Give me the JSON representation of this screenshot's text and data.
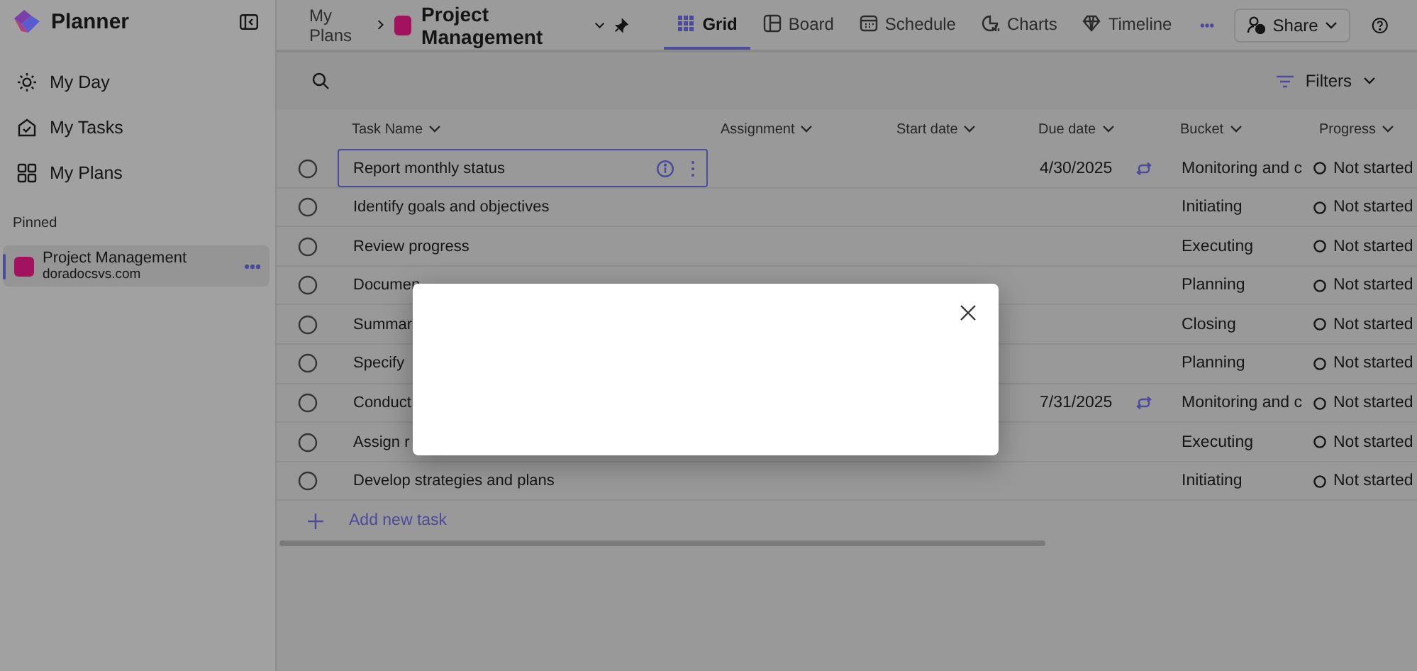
{
  "app": {
    "name": "Planner"
  },
  "sidebar": {
    "items": [
      {
        "label": "My Day"
      },
      {
        "label": "My Tasks"
      },
      {
        "label": "My Plans"
      }
    ],
    "pinned_heading": "Pinned",
    "pinned": [
      {
        "title": "Project Management",
        "subtitle": "doradocsvs.com",
        "selected": true
      }
    ]
  },
  "breadcrumb": {
    "root": "My Plans",
    "plan": "Project Management"
  },
  "tabs": [
    {
      "label": "Grid",
      "selected": true
    },
    {
      "label": "Board",
      "selected": false
    },
    {
      "label": "Schedule",
      "selected": false
    },
    {
      "label": "Charts",
      "selected": false
    },
    {
      "label": "Timeline",
      "selected": false
    }
  ],
  "share_button": "Share",
  "filters_button": "Filters",
  "table": {
    "columns": [
      "Task Name",
      "Assignment",
      "Start date",
      "Due date",
      "Bucket",
      "Progress"
    ],
    "rows": [
      {
        "task": "Report monthly status",
        "due": "4/30/2025",
        "repeat": true,
        "bucket": "Monitoring and c",
        "progress": "Not started",
        "checked": false,
        "focused": true
      },
      {
        "task": "Identify goals and objectives",
        "repeat": false,
        "bucket": "Initiating",
        "progress": "Not started",
        "checked": false,
        "focused": false
      },
      {
        "task": "Review progress",
        "repeat": false,
        "bucket": "Executing",
        "progress": "Not started",
        "checked": false,
        "focused": false
      },
      {
        "task": "Documen",
        "repeat": false,
        "bucket": "Planning",
        "progress": "Not started",
        "checked": false,
        "focused": false
      },
      {
        "task": "Summar",
        "repeat": false,
        "bucket": "Closing",
        "progress": "Not started",
        "checked": false,
        "focused": false
      },
      {
        "task": "Specify",
        "repeat": false,
        "bucket": "Planning",
        "progress": "Not started",
        "checked": false,
        "focused": false
      },
      {
        "task": "Conduct",
        "due": "7/31/2025",
        "repeat": true,
        "bucket": "Monitoring and c",
        "progress": "Not started",
        "checked": false,
        "focused": false
      },
      {
        "task": "Assign r",
        "repeat": false,
        "bucket": "Executing",
        "progress": "Not started",
        "checked": false,
        "focused": false
      },
      {
        "task": "Develop strategies and plans",
        "repeat": false,
        "bucket": "Initiating",
        "progress": "Not started",
        "checked": false,
        "focused": false
      }
    ],
    "add_task": "Add new task"
  },
  "dialog": {
    "open": true
  }
}
